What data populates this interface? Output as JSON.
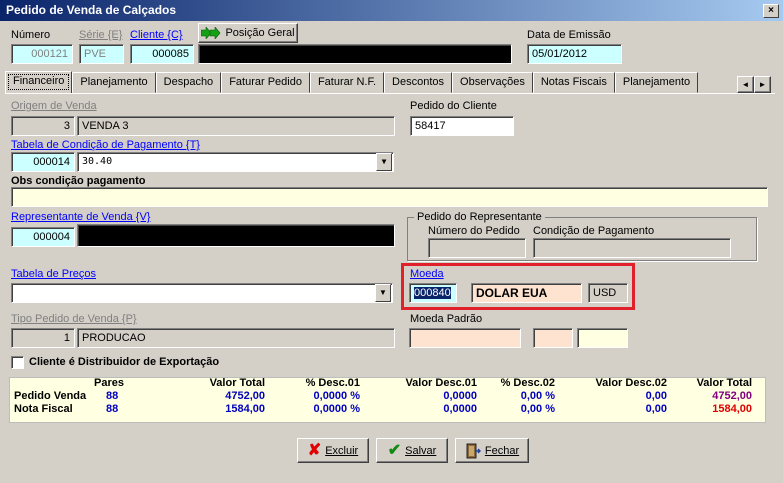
{
  "window": {
    "title": "Pedido de Venda de Calçados",
    "close_label": "×"
  },
  "header": {
    "numero_label": "Número",
    "numero_value": "000121",
    "serie_label": "Série {E}",
    "serie_value": "PVE",
    "cliente_label": "Cliente {C}",
    "cliente_value": "000085",
    "posicao_geral_label": "Posição Geral",
    "data_emissao_label": "Data de Emissão",
    "data_emissao_value": "05/01/2012"
  },
  "tabs": [
    {
      "label": "Financeiro"
    },
    {
      "label": "Planejamento"
    },
    {
      "label": "Despacho"
    },
    {
      "label": "Faturar Pedido"
    },
    {
      "label": "Faturar N.F."
    },
    {
      "label": "Descontos"
    },
    {
      "label": "Observações"
    },
    {
      "label": "Notas Fiscais"
    },
    {
      "label": "Planejamento"
    }
  ],
  "tab_scroll": {
    "left": "◄",
    "right": "►"
  },
  "form": {
    "origem_label": "Origem de Venda",
    "origem_code": "3",
    "origem_name": "VENDA 3",
    "pedido_cliente_label": "Pedido do Cliente",
    "pedido_cliente_value": "58417",
    "tabela_cond_label": "Tabela de Condição de Pagamento {T}",
    "tabela_cond_code": "000014",
    "tabela_cond_value": "30.40",
    "obs_label": "Obs condição pagamento",
    "obs_value": "",
    "representante_label": "Representante de Venda {V}",
    "representante_code": "000004",
    "pedido_rep_group": "Pedido do Representante",
    "numero_pedido_label": "Número do Pedido",
    "condicao_pagamento_label": "Condição de Pagamento",
    "tabela_precos_label": "Tabela de Preços",
    "tabela_precos_value": "",
    "moeda_label": "Moeda",
    "moeda_code": "000840",
    "moeda_name": "DOLAR EUA",
    "moeda_symbol": "USD",
    "tipo_pedido_label": "Tipo Pedido de Venda {P}",
    "tipo_pedido_code": "1",
    "tipo_pedido_name": "PRODUCAO",
    "moeda_padrao_label": "Moeda Padrão",
    "distribuidor_label": "Cliente é Distribuidor de Exportação"
  },
  "summary": {
    "headers": [
      "Pares",
      "Valor Total",
      "% Desc.01",
      "Valor Desc.01",
      "% Desc.02",
      "Valor Desc.02",
      "Valor Total"
    ],
    "rows": [
      {
        "label": "Pedido Venda",
        "values": [
          "88",
          "4752,00",
          "0,0000 %",
          "0,0000",
          "0,00 %",
          "0,00",
          "4752,00"
        ]
      },
      {
        "label": "Nota Fiscal",
        "values": [
          "88",
          "1584,00",
          "0,0000 %",
          "0,0000",
          "0,00 %",
          "0,00",
          "1584,00"
        ]
      }
    ]
  },
  "buttons": {
    "excluir": "Excluir",
    "salvar": "Salvar",
    "fechar": "Fechar"
  },
  "colors": {
    "highlight": "#e0202a",
    "cyan_field": "#ccffff",
    "yellow_field": "#ffffe1"
  }
}
